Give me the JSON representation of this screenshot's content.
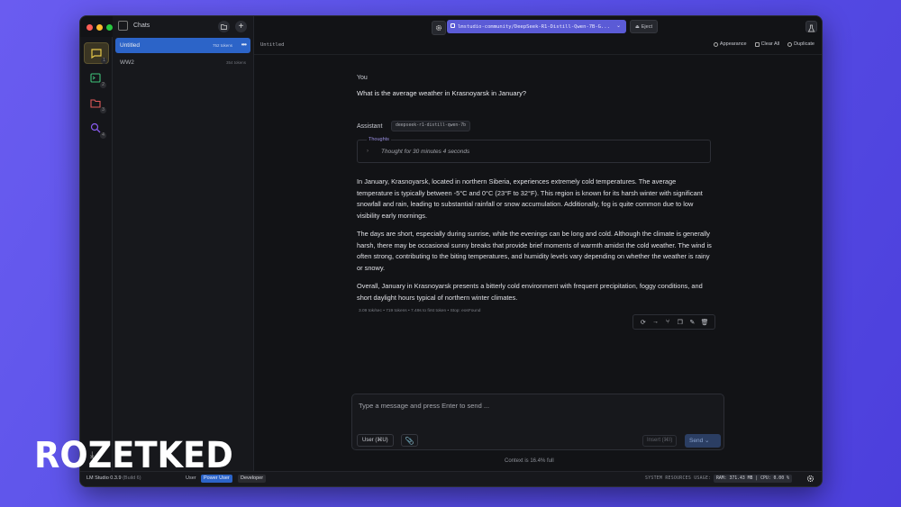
{
  "window": {
    "chats_title": "Chats"
  },
  "chats": [
    {
      "name": "Untitled",
      "tokens": "752 tokens",
      "more": "•••",
      "active": true
    },
    {
      "name": "WW2",
      "tokens": "354 tokens",
      "active": false
    }
  ],
  "rail": {
    "badges": [
      "1",
      "2",
      "3",
      "4"
    ]
  },
  "topbar": {
    "model": "lmstudio-community/DeepSeek-R1-Distill-Qwen-7B-G...",
    "eject_label": "Eject"
  },
  "subbar": {
    "chat_title": "Untitled",
    "appearance_label": "Appearance",
    "clear_all_label": "Clear All",
    "duplicate_label": "Duplicate"
  },
  "conversation": {
    "user_role": "You",
    "user_message": "What is the average weather in Krasnoyarsk in January?",
    "assistant_role": "Assistant",
    "assistant_model": "deepseek-r1-distill-qwen-7b",
    "thoughts_label": "Thoughts",
    "thoughts_text": "Thought for 30 minutes 4 seconds",
    "paragraphs": [
      "In January, Krasnoyarsk, located in northern Siberia, experiences extremely cold temperatures. The average temperature is typically between -5°C and 0°C (23°F to 32°F). This region is known for its harsh winter with significant snowfall and rain, leading to substantial rainfall or snow accumulation. Additionally, fog is quite common due to low visibility early mornings.",
      "The days are short, especially during sunrise, while the evenings can be long and cold. Although the climate is generally harsh, there may be occasional sunny breaks that provide brief moments of warmth amidst the cold weather. The wind is often strong, contributing to the biting temperatures, and humidity levels vary depending on whether the weather is rainy or snowy.",
      "Overall, January in Krasnoyarsk presents a bitterly cold environment with frequent precipitation, foggy conditions, and short daylight hours typical of northern winter climates."
    ],
    "stats": "3.09 tok/sec  •  719 tokens  •  7.49s to first token  •  Stop: eosFound"
  },
  "composer": {
    "placeholder": "Type a message and press Enter to send ...",
    "role_label": "User (⌘U)",
    "insert_label": "Insert (⌘I)",
    "send_label": "Send  ⌄",
    "context": "Context is 16.4% full"
  },
  "statusbar": {
    "app_name": "LM Studio 0.3.9",
    "build": "(Build 6)",
    "modes": [
      "User",
      "Power User",
      "Developer"
    ],
    "resources_label": "SYSTEM RESOURCES USAGE:",
    "resources_value": "RAM: 371.43 MB  |  CPU: 0.00 %"
  },
  "watermark": "ROZETKED",
  "colors": {
    "accent": "#5b5bd6",
    "active_chat": "#2c64c8",
    "background": "#121316"
  }
}
